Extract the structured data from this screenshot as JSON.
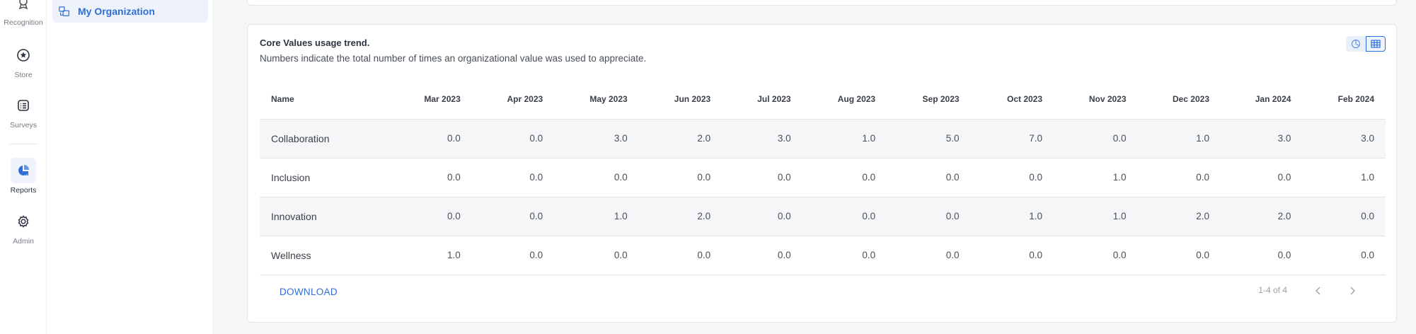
{
  "rail": {
    "items": [
      {
        "label": "Recognition",
        "icon": "award-icon"
      },
      {
        "label": "Store",
        "icon": "star-circle-icon"
      },
      {
        "label": "Surveys",
        "icon": "survey-list-icon"
      },
      {
        "label": "Reports",
        "icon": "pie-chart-icon",
        "active": true
      },
      {
        "label": "Admin",
        "icon": "gear-icon"
      }
    ]
  },
  "submenu": {
    "active_item": "My Organization",
    "icon": "organization-icon"
  },
  "card": {
    "title": "Core Values usage trend.",
    "subtitle": "Numbers indicate the total number of times an organizational value was used to appreciate.",
    "view_toggle": [
      "chart-view-icon",
      "table-view-icon"
    ],
    "table": {
      "columns": [
        "Name",
        "Mar 2023",
        "Apr 2023",
        "May 2023",
        "Jun 2023",
        "Jul 2023",
        "Aug 2023",
        "Sep 2023",
        "Oct 2023",
        "Nov 2023",
        "Dec 2023",
        "Jan 2024",
        "Feb 2024"
      ],
      "rows": [
        [
          "Collaboration",
          "0.0",
          "0.0",
          "3.0",
          "2.0",
          "3.0",
          "1.0",
          "5.0",
          "7.0",
          "0.0",
          "1.0",
          "3.0",
          "3.0"
        ],
        [
          "Inclusion",
          "0.0",
          "0.0",
          "0.0",
          "0.0",
          "0.0",
          "0.0",
          "0.0",
          "0.0",
          "1.0",
          "0.0",
          "0.0",
          "1.0"
        ],
        [
          "Innovation",
          "0.0",
          "0.0",
          "1.0",
          "2.0",
          "0.0",
          "0.0",
          "0.0",
          "1.0",
          "1.0",
          "2.0",
          "2.0",
          "0.0"
        ],
        [
          "Wellness",
          "1.0",
          "0.0",
          "0.0",
          "0.0",
          "0.0",
          "0.0",
          "0.0",
          "0.0",
          "0.0",
          "0.0",
          "0.0",
          "0.0"
        ]
      ]
    },
    "download_label": "DOWNLOAD",
    "pagination": "1-4 of 4"
  },
  "colors": {
    "accent": "#2f6fd6",
    "active_bg": "#eef3fb",
    "row_shade": "#f5f6f8"
  }
}
